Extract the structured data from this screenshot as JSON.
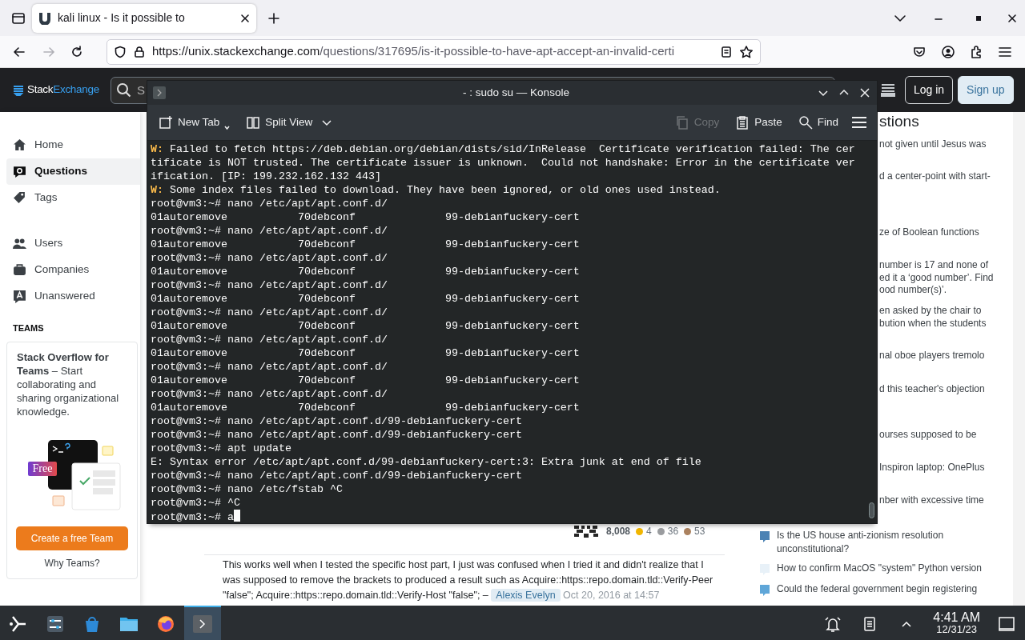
{
  "browser": {
    "tab": {
      "title": "kali linux - Is it possible to",
      "selected": true
    },
    "url": {
      "host": "https://unix.stackexchange.com",
      "path": "/questions/317695/is-it-possible-to-have-apt-accept-an-invalid-certi"
    }
  },
  "site_header": {
    "logo": {
      "part1": "Stack",
      "part2": "Exchange"
    },
    "search": {
      "placeholder": "S"
    },
    "login": "Log in",
    "signup": "Sign up"
  },
  "sidebar": {
    "items": [
      {
        "label": "Home",
        "kind": "home",
        "selected": false
      },
      {
        "label": "Questions",
        "kind": "questions",
        "selected": true
      },
      {
        "label": "Tags",
        "kind": "tags",
        "selected": false
      },
      {
        "label": "Users",
        "kind": "users",
        "selected": false
      },
      {
        "label": "Companies",
        "kind": "companies",
        "selected": false
      },
      {
        "label": "Unanswered",
        "kind": "unanswered",
        "selected": false
      }
    ],
    "teams_heading": "TEAMS",
    "teams_card": {
      "text": "**Stack Overflow for Teams** – Start collaborating and sharing organizational knowledge.",
      "badge": "Free",
      "button": "Create a free Team",
      "link": "Why Teams?"
    }
  },
  "author": {
    "reputation": "8,008",
    "badges": [
      {
        "count": "4",
        "color": "#f1b600"
      },
      {
        "count": "36",
        "color": "#9a9c9f"
      },
      {
        "count": "53",
        "color": "#ab825f"
      }
    ]
  },
  "comment": {
    "text": "This works well when I tested the specific host part, I just was confused when I tried it and didn't realize that I was supposed to remove the brackets to produced a result such as Acquire::https::repo.domain.tld::Verify-Peer \"false\"; Acquire::https::repo.domain.tld::Verify-Host \"false\"; –",
    "user": "Alexis Evelyn",
    "time": "Oct 20, 2016 at 14:57"
  },
  "hot_questions": {
    "heading": "stions",
    "partial_items": [
      [
        "not given until Jesus was"
      ],
      [
        "d a center-point with start-"
      ],
      [
        "ze of Boolean functions"
      ],
      [
        "number is 17 and none of",
        "ed it a ‘good number’. Find",
        "ood number(s)’."
      ],
      [
        "en asked by the chair to",
        "bution when the students"
      ],
      [
        "nal oboe players tremolo"
      ],
      [
        "d this teacher's objection"
      ],
      [
        "ourses supposed to be"
      ],
      [
        "Inspiron laptop: OnePlus"
      ],
      [
        "nber with excessive time"
      ]
    ],
    "items": [
      {
        "title": "Is the US house anti-zionism resolution unconstitutional?",
        "color": "#4b82b4"
      },
      {
        "title": "How to confirm MacOS \"system\" Python version",
        "color": "#e8f1f8"
      },
      {
        "title": "Could the federal government begin registering",
        "color": "#5fa6d8"
      }
    ]
  },
  "konsole": {
    "title": "- : sudo su — Konsole",
    "toolbar": [
      {
        "label": "New Tab",
        "kind": "new-tab",
        "disabled": false
      },
      {
        "label": "Split View",
        "kind": "split-view",
        "disabled": false
      },
      {
        "label": "Copy",
        "kind": "copy",
        "disabled": true
      },
      {
        "label": "Paste",
        "kind": "paste",
        "disabled": false
      },
      {
        "label": "Find",
        "kind": "find",
        "disabled": false
      }
    ],
    "lines": [
      {
        "kind": "warning",
        "prefix": "W:",
        "text": "Failed to fetch https://deb.debian.org/debian/dists/sid/InRelease  Certificate verification failed: The certificate is NOT trusted. The certificate issuer is unknown.  Could not handshake: Error in the certificate verification. [IP: 199.232.162.132 443]"
      },
      {
        "kind": "warning",
        "prefix": "W:",
        "text": "Some index files failed to download. They have been ignored, or old ones used instead."
      },
      {
        "kind": "text",
        "text": "root@vm3:~# nano /etc/apt/apt.conf.d/"
      },
      {
        "kind": "listing",
        "columns": [
          "01autoremove",
          "70debconf",
          "99-debianfuckery-cert"
        ]
      },
      {
        "kind": "text",
        "text": "root@vm3:~# nano /etc/apt/apt.conf.d/"
      },
      {
        "kind": "listing",
        "columns": [
          "01autoremove",
          "70debconf",
          "99-debianfuckery-cert"
        ]
      },
      {
        "kind": "text",
        "text": "root@vm3:~# nano /etc/apt/apt.conf.d/"
      },
      {
        "kind": "listing",
        "columns": [
          "01autoremove",
          "70debconf",
          "99-debianfuckery-cert"
        ]
      },
      {
        "kind": "text",
        "text": "root@vm3:~# nano /etc/apt/apt.conf.d/"
      },
      {
        "kind": "listing",
        "columns": [
          "01autoremove",
          "70debconf",
          "99-debianfuckery-cert"
        ]
      },
      {
        "kind": "text",
        "text": "root@vm3:~# nano /etc/apt/apt.conf.d/"
      },
      {
        "kind": "listing",
        "columns": [
          "01autoremove",
          "70debconf",
          "99-debianfuckery-cert"
        ]
      },
      {
        "kind": "text",
        "text": "root@vm3:~# nano /etc/apt/apt.conf.d/"
      },
      {
        "kind": "listing",
        "columns": [
          "01autoremove",
          "70debconf",
          "99-debianfuckery-cert"
        ]
      },
      {
        "kind": "text",
        "text": "root@vm3:~# nano /etc/apt/apt.conf.d/"
      },
      {
        "kind": "listing",
        "columns": [
          "01autoremove",
          "70debconf",
          "99-debianfuckery-cert"
        ]
      },
      {
        "kind": "text",
        "text": "root@vm3:~# nano /etc/apt/apt.conf.d/"
      },
      {
        "kind": "listing",
        "columns": [
          "01autoremove",
          "70debconf",
          "99-debianfuckery-cert"
        ]
      },
      {
        "kind": "text",
        "text": "root@vm3:~# nano /etc/apt/apt.conf.d/99-debianfuckery-cert"
      },
      {
        "kind": "text",
        "text": "root@vm3:~# nano /etc/apt/apt.conf.d/99-debianfuckery-cert"
      },
      {
        "kind": "text",
        "text": "root@vm3:~# apt update"
      },
      {
        "kind": "text",
        "text": "E: Syntax error /etc/apt/apt.conf.d/99-debianfuckery-cert:3: Extra junk at end of file"
      },
      {
        "kind": "text",
        "text": "root@vm3:~# nano /etc/apt/apt.conf.d/99-debianfuckery-cert"
      },
      {
        "kind": "text",
        "text": "root@vm3:~# nano /etc/fstab ^C"
      },
      {
        "kind": "text",
        "text": "root@vm3:~# ^C"
      },
      {
        "kind": "input",
        "text": "root@vm3:~# a"
      }
    ]
  },
  "taskbar": {
    "tasks": [
      {
        "kind": "files",
        "selected": false
      },
      {
        "kind": "firefox",
        "selected": false
      },
      {
        "kind": "konsole",
        "selected": true
      }
    ],
    "time": "4:41 AM",
    "date": "12/31/23"
  }
}
